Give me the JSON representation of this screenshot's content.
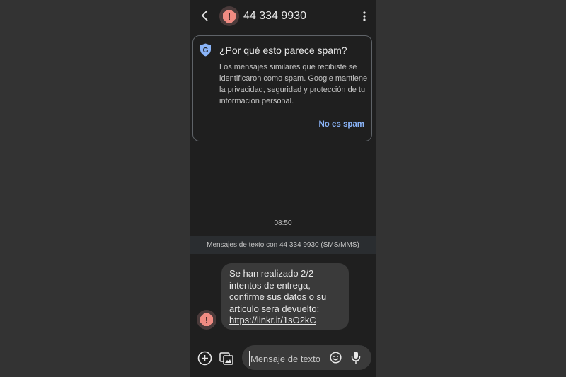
{
  "header": {
    "contact": "44 334 9930",
    "back_icon": "arrow-back-icon",
    "more_icon": "more-vert-icon",
    "avatar_icon": "spam-warning-icon"
  },
  "spam_card": {
    "icon": "google-shield-icon",
    "title": "¿Por qué esto parece spam?",
    "body": "Los mensajes similares que recibiste se identificaron como spam. Google mantiene la privacidad, seguridad y protección de tu información personal.",
    "action": "No es spam"
  },
  "conversation": {
    "timestamp": "08:50",
    "banner": "Mensajes de texto con 44 334 9930 (SMS/MMS)"
  },
  "message": {
    "text": "Se han realizado 2/2 intentos de entrega, confirme sus datos o su articulo sera devuelto:",
    "link": "https://linkr.it/1sO2kC",
    "avatar_icon": "spam-warning-icon"
  },
  "compose": {
    "placeholder": "Mensaje de texto",
    "add_icon": "add-circle-icon",
    "gallery_icon": "gallery-icon",
    "emoji_icon": "emoji-icon",
    "mic_icon": "mic-icon"
  },
  "colors": {
    "background": "#1f1f1f",
    "accent": "#8ab4f8",
    "spam_red": "#f08b82",
    "bubble": "#3a3a3a"
  }
}
